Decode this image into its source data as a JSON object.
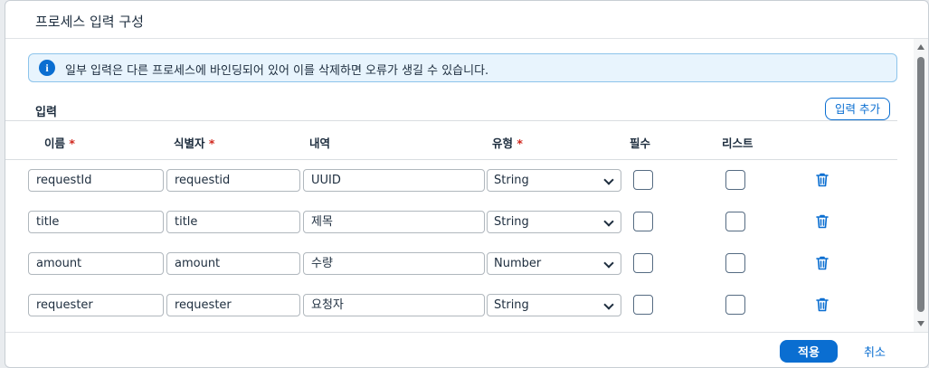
{
  "dialog": {
    "title": "프로세스 입력 구성",
    "info_message": "일부 입력은 다른 프로세스에 바인딩되어 있어 이를 삭제하면 오류가 생길 수 있습니다.",
    "section_title": "입력",
    "add_input_label": "입력 추가",
    "columns": {
      "name": "이름",
      "identifier": "식별자",
      "description": "내역",
      "type": "유형",
      "required": "필수",
      "list": "리스트",
      "required_marker": "*"
    },
    "rows": [
      {
        "name": "requestId",
        "identifier": "requestid",
        "description": "UUID",
        "type": "String",
        "required": false,
        "list": false
      },
      {
        "name": "title",
        "identifier": "title",
        "description": "제목",
        "type": "String",
        "required": false,
        "list": false
      },
      {
        "name": "amount",
        "identifier": "amount",
        "description": "수량",
        "type": "Number",
        "required": false,
        "list": false
      },
      {
        "name": "requester",
        "identifier": "requester",
        "description": "요청자",
        "type": "String",
        "required": false,
        "list": false
      }
    ],
    "apply_label": "적용",
    "cancel_label": "취소"
  },
  "colors": {
    "accent": "#0a6ed1",
    "info_bg": "#e8f4fd",
    "required_marker": "#d0271d"
  },
  "icons": {
    "info": "info-icon",
    "delete": "trash-icon",
    "dropdown": "chevron-down-icon"
  }
}
